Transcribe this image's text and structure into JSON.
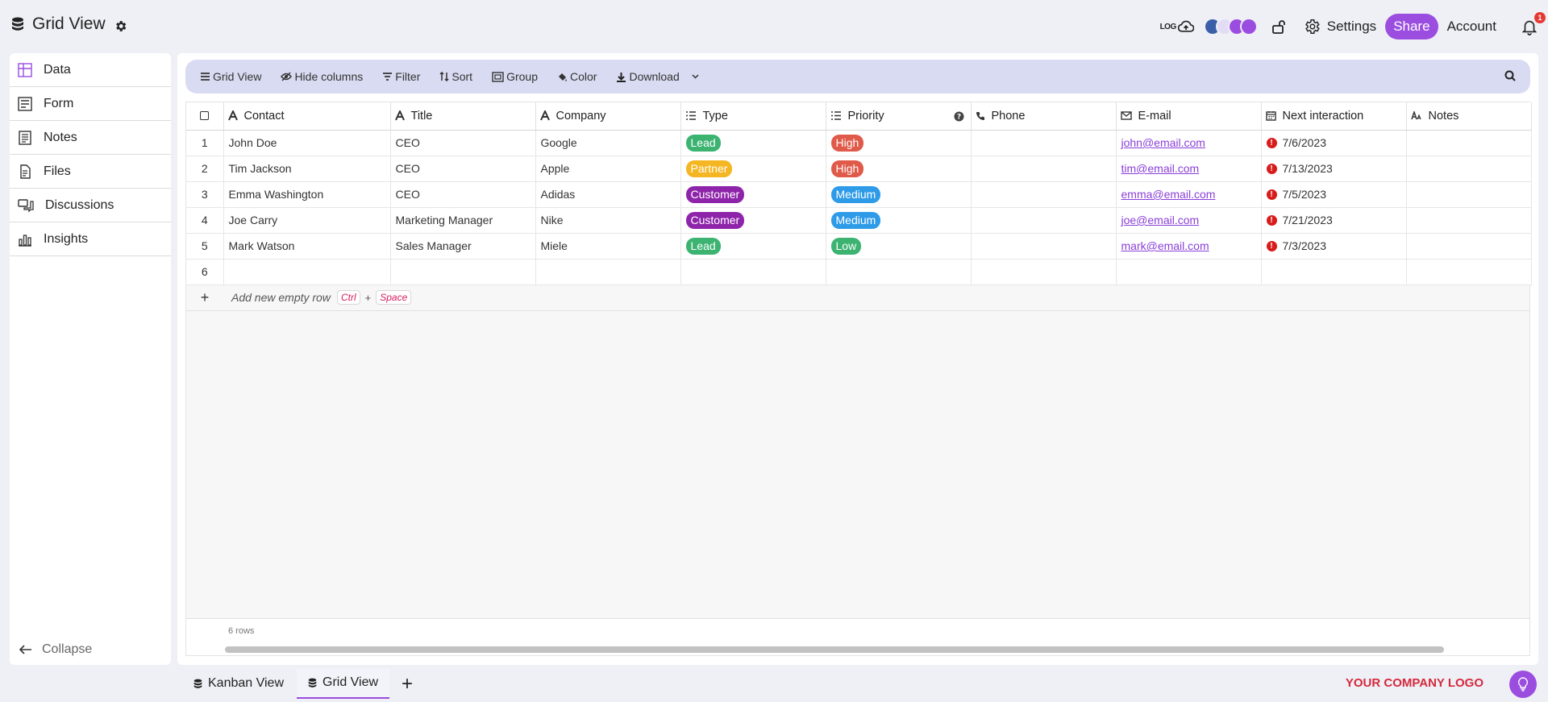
{
  "app": {
    "title": "Grid View"
  },
  "topbar": {
    "log_label": "LOG",
    "settings_label": "Settings",
    "share_label": "Share",
    "account_label": "Account",
    "notification_count": "1",
    "avatar_colors": [
      "#3a5fa8",
      "#c9b8f0",
      "#9b4de0",
      "#9b4de0"
    ]
  },
  "sidebar": {
    "items": [
      {
        "label": "Data",
        "icon": "grid-icon"
      },
      {
        "label": "Form",
        "icon": "form-icon"
      },
      {
        "label": "Notes",
        "icon": "notes-icon"
      },
      {
        "label": "Files",
        "icon": "files-icon"
      },
      {
        "label": "Discussions",
        "icon": "discussions-icon"
      },
      {
        "label": "Insights",
        "icon": "insights-icon"
      }
    ],
    "collapse_label": "Collapse"
  },
  "toolbar": {
    "grid_view": "Grid View",
    "hide_columns": "Hide columns",
    "filter": "Filter",
    "sort": "Sort",
    "group": "Group",
    "color": "Color",
    "download": "Download"
  },
  "grid": {
    "columns": [
      "Contact",
      "Title",
      "Company",
      "Type",
      "Priority",
      "Phone",
      "E-mail",
      "Next interaction",
      "Notes"
    ],
    "rows": [
      {
        "num": "1",
        "contact": "John Doe",
        "title": "CEO",
        "company": "Google",
        "type": "Lead",
        "priority": "High",
        "phone": "",
        "email": "john@email.com",
        "next": "7/6/2023",
        "notes": ""
      },
      {
        "num": "2",
        "contact": "Tim Jackson",
        "title": "CEO",
        "company": "Apple",
        "type": "Partner",
        "priority": "High",
        "phone": "",
        "email": "tim@email.com",
        "next": "7/13/2023",
        "notes": ""
      },
      {
        "num": "3",
        "contact": "Emma Washington",
        "title": "CEO",
        "company": "Adidas",
        "type": "Customer",
        "priority": "Medium",
        "phone": "",
        "email": "emma@email.com",
        "next": "7/5/2023",
        "notes": ""
      },
      {
        "num": "4",
        "contact": "Joe Carry",
        "title": "Marketing Manager",
        "company": "Nike",
        "type": "Customer",
        "priority": "Medium",
        "phone": "",
        "email": "joe@email.com",
        "next": "7/21/2023",
        "notes": ""
      },
      {
        "num": "5",
        "contact": "Mark Watson",
        "title": "Sales Manager",
        "company": "Miele",
        "type": "Lead",
        "priority": "Low",
        "phone": "",
        "email": "mark@email.com",
        "next": "7/3/2023",
        "notes": ""
      },
      {
        "num": "6",
        "contact": "",
        "title": "",
        "company": "",
        "type": "",
        "priority": "",
        "phone": "",
        "email": "",
        "next": "",
        "notes": ""
      }
    ],
    "add_row_label": "Add new empty row",
    "shortcut_ctrl": "Ctrl",
    "shortcut_plus": "+",
    "shortcut_space": "Space",
    "row_count": "6 rows"
  },
  "tag_colors": {
    "Lead": "#3cb371",
    "Partner": "#f5b623",
    "Customer": "#8e24aa",
    "High": "#e05a4a",
    "Medium": "#2e9be8",
    "Low": "#3cb371"
  },
  "bottom": {
    "tabs": [
      {
        "label": "Kanban View"
      },
      {
        "label": "Grid View"
      }
    ],
    "company_logo": "YOUR COMPANY LOGO"
  }
}
